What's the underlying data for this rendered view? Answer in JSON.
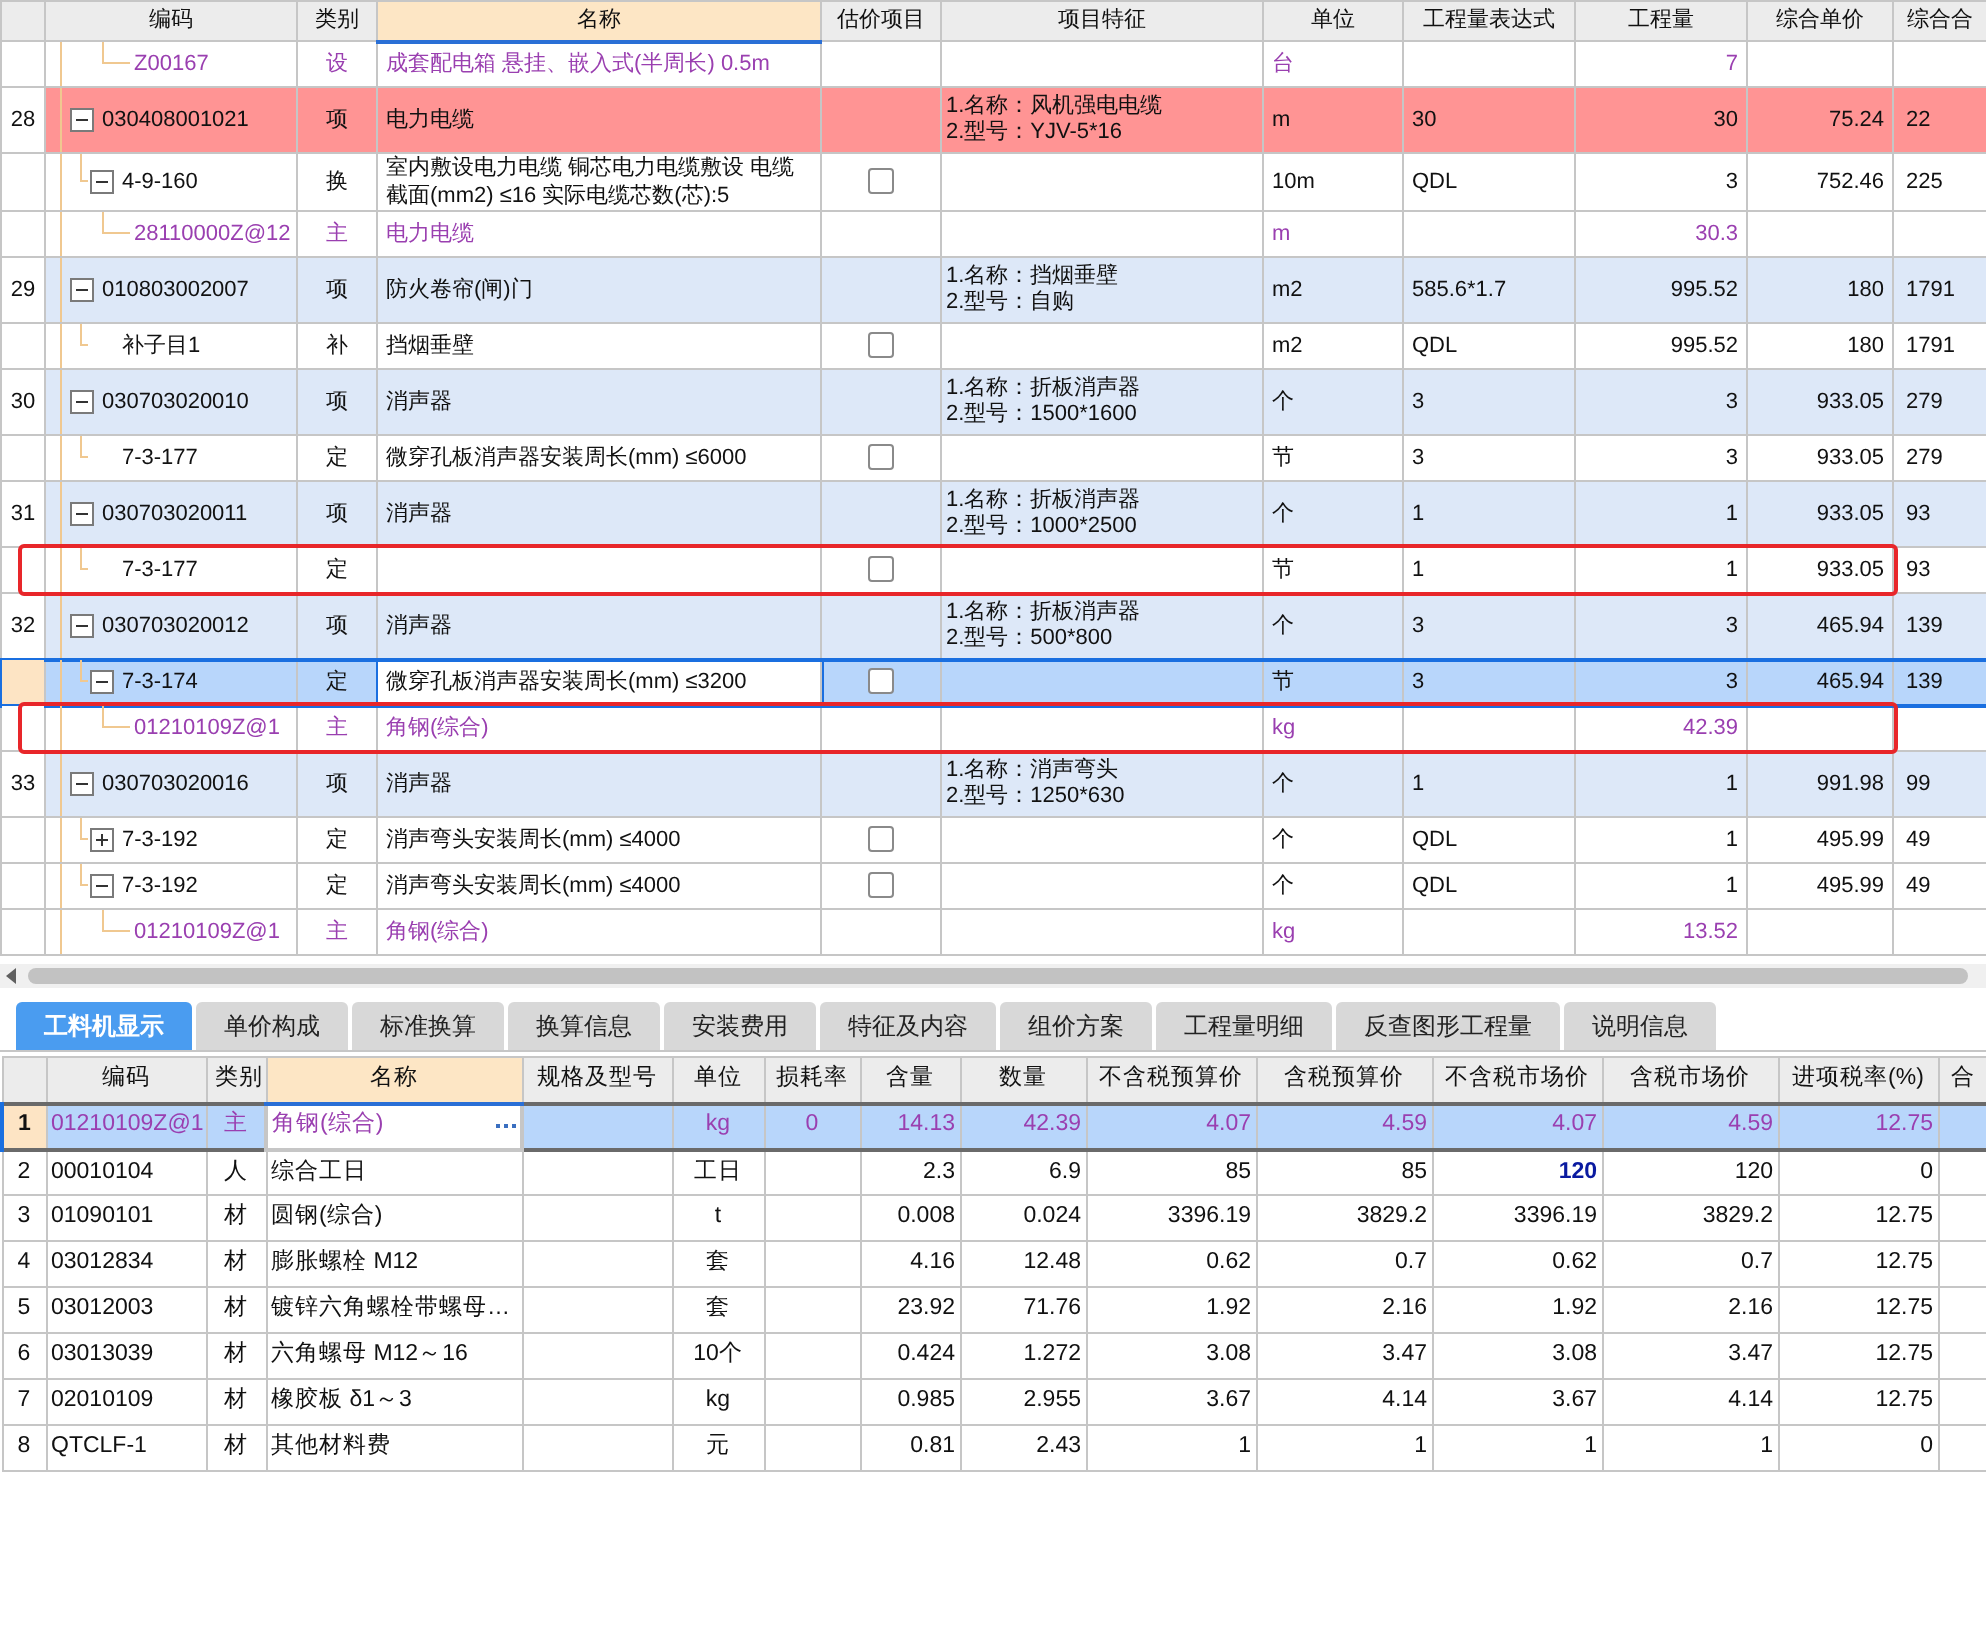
{
  "top_table": {
    "columns": [
      {
        "label": "编码",
        "selected": false
      },
      {
        "label": "类别",
        "selected": false
      },
      {
        "label": "名称",
        "selected": true
      },
      {
        "label": "估价项目",
        "selected": false
      },
      {
        "label": "项目特征",
        "selected": false
      },
      {
        "label": "单位",
        "selected": false
      },
      {
        "label": "工程量表达式",
        "selected": false
      },
      {
        "label": "工程量",
        "selected": false
      },
      {
        "label": "综合单价",
        "selected": false
      },
      {
        "label": "综合合",
        "selected": false
      }
    ],
    "rows": [
      {
        "code": "Z00167",
        "type": "设",
        "kind": "material",
        "name": "成套配电箱 悬挂、嵌入式(半周长) 0.5m",
        "unit": "台",
        "quantity": "7",
        "selected": false,
        "highlighted": false
      },
      {
        "number": "28",
        "code": "030408001021",
        "type": "项",
        "kind": "bill",
        "name": "电力电缆",
        "features": [
          "1.名称：风机强电电缆",
          "2.型号：YJV-5*16"
        ],
        "unit": "m",
        "expression": "30",
        "quantity": "30",
        "unit_price": "75.24",
        "total": "22",
        "alert": true,
        "expanded": true,
        "selected": false,
        "highlighted": false,
        "children": [
          {
            "code": "4-9-160",
            "type": "换",
            "kind": "quota",
            "name": "室内敷设电力电缆 铜芯电力电缆敷设 电缆截面(mm2) ≤16  实际电缆芯数(芯):5",
            "estimate": false,
            "unit": "10m",
            "expression": "QDL",
            "quantity": "3",
            "unit_price": "752.46",
            "total": "225",
            "expanded": true,
            "selected": false,
            "highlighted": false,
            "children": [
              {
                "code": "28110000Z@12",
                "type": "主",
                "kind": "material",
                "name": "电力电缆",
                "unit": "m",
                "quantity": "30.3",
                "selected": false,
                "highlighted": false
              }
            ]
          }
        ]
      },
      {
        "number": "29",
        "code": "010803002007",
        "type": "项",
        "kind": "bill",
        "name": "防火卷帘(闸)门",
        "features": [
          "1.名称：挡烟垂壁",
          "2.型号：自购"
        ],
        "unit": "m2",
        "expression": "585.6*1.7",
        "quantity": "995.52",
        "unit_price": "180",
        "total": "1791",
        "alert": false,
        "expanded": true,
        "selected": false,
        "highlighted": false,
        "children": [
          {
            "code": "补子目1",
            "type": "补",
            "kind": "quota",
            "name": "挡烟垂壁",
            "estimate": false,
            "unit": "m2",
            "expression": "QDL",
            "quantity": "995.52",
            "unit_price": "180",
            "total": "1791",
            "selected": false,
            "highlighted": false
          }
        ]
      },
      {
        "number": "30",
        "code": "030703020010",
        "type": "项",
        "kind": "bill",
        "name": "消声器",
        "features": [
          "1.名称：折板消声器",
          "2.型号：1500*1600"
        ],
        "unit": "个",
        "expression": "3",
        "quantity": "3",
        "unit_price": "933.05",
        "total": "279",
        "alert": false,
        "expanded": true,
        "selected": false,
        "highlighted": false,
        "children": [
          {
            "code": "7-3-177",
            "type": "定",
            "kind": "quota",
            "name": "微穿孔板消声器安装周长(mm) ≤6000",
            "estimate": false,
            "unit": "节",
            "expression": "3",
            "quantity": "3",
            "unit_price": "933.05",
            "total": "279",
            "selected": false,
            "highlighted": false
          }
        ]
      },
      {
        "number": "31",
        "code": "030703020011",
        "type": "项",
        "kind": "bill",
        "name": "消声器",
        "features": [
          "1.名称：折板消声器",
          "2.型号：1000*2500"
        ],
        "unit": "个",
        "expression": "1",
        "quantity": "1",
        "unit_price": "933.05",
        "total": "93",
        "alert": false,
        "expanded": true,
        "selected": false,
        "highlighted": false,
        "children": [
          {
            "code": "7-3-177",
            "type": "定",
            "kind": "quota",
            "estimate": false,
            "unit": "节",
            "expression": "1",
            "quantity": "1",
            "unit_price": "933.05",
            "total": "93",
            "selected": false,
            "highlighted": true
          }
        ]
      },
      {
        "number": "32",
        "code": "030703020012",
        "type": "项",
        "kind": "bill",
        "name": "消声器",
        "features": [
          "1.名称：折板消声器",
          "2.型号：500*800"
        ],
        "unit": "个",
        "expression": "3",
        "quantity": "3",
        "unit_price": "465.94",
        "total": "139",
        "alert": false,
        "expanded": true,
        "selected": false,
        "highlighted": false,
        "children": [
          {
            "code": "7-3-174",
            "type": "定",
            "kind": "quota",
            "name": "微穿孔板消声器安装周长(mm) ≤3200",
            "estimate": false,
            "unit": "节",
            "expression": "3",
            "quantity": "3",
            "unit_price": "465.94",
            "total": "139",
            "expanded": true,
            "selected": true,
            "highlighted": false,
            "children": [
              {
                "code": "01210109Z@1",
                "type": "主",
                "kind": "material",
                "name": "角钢(综合)",
                "unit": "kg",
                "quantity": "42.39",
                "selected": false,
                "highlighted": true
              }
            ]
          }
        ]
      },
      {
        "number": "33",
        "code": "030703020016",
        "type": "项",
        "kind": "bill",
        "name": "消声器",
        "features": [
          "1.名称：消声弯头",
          "2.型号：1250*630"
        ],
        "unit": "个",
        "expression": "1",
        "quantity": "1",
        "unit_price": "991.98",
        "total": "99",
        "alert": false,
        "expanded": true,
        "selected": false,
        "highlighted": false,
        "children": [
          {
            "code": "7-3-192",
            "type": "定",
            "kind": "quota",
            "name": "消声弯头安装周长(mm) ≤4000",
            "estimate": false,
            "unit": "个",
            "expression": "QDL",
            "quantity": "1",
            "unit_price": "495.99",
            "total": "49",
            "expanded": false,
            "selected": false,
            "highlighted": false
          },
          {
            "code": "7-3-192",
            "type": "定",
            "kind": "quota",
            "name": "消声弯头安装周长(mm) ≤4000",
            "estimate": false,
            "unit": "个",
            "expression": "QDL",
            "quantity": "1",
            "unit_price": "495.99",
            "total": "49",
            "expanded": true,
            "selected": false,
            "highlighted": false,
            "children": [
              {
                "code": "01210109Z@1",
                "type": "主",
                "kind": "material",
                "name": "角钢(综合)",
                "unit": "kg",
                "quantity": "13.52",
                "selected": false,
                "highlighted": false
              }
            ]
          }
        ]
      }
    ]
  },
  "tabs": [
    {
      "label": "工料机显示",
      "selected": true
    },
    {
      "label": "单价构成",
      "selected": false
    },
    {
      "label": "标准换算",
      "selected": false
    },
    {
      "label": "换算信息",
      "selected": false
    },
    {
      "label": "安装费用",
      "selected": false
    },
    {
      "label": "特征及内容",
      "selected": false
    },
    {
      "label": "组价方案",
      "selected": false
    },
    {
      "label": "工程量明细",
      "selected": false
    },
    {
      "label": "反查图形工程量",
      "selected": false
    },
    {
      "label": "说明信息",
      "selected": false
    }
  ],
  "bottom_table": {
    "columns": [
      {
        "label": "编码",
        "selected": false
      },
      {
        "label": "类别",
        "selected": false
      },
      {
        "label": "名称",
        "selected": true
      },
      {
        "label": "规格及型号",
        "selected": false
      },
      {
        "label": "单位",
        "selected": false
      },
      {
        "label": "损耗率",
        "selected": false
      },
      {
        "label": "含量",
        "selected": false
      },
      {
        "label": "数量",
        "selected": false
      },
      {
        "label": "不含税预算价",
        "selected": false
      },
      {
        "label": "含税预算价",
        "selected": false
      },
      {
        "label": "不含税市场价",
        "selected": false
      },
      {
        "label": "含税市场价",
        "selected": false
      },
      {
        "label": "进项税率(%)",
        "selected": false
      },
      {
        "label": "合",
        "selected": false
      }
    ],
    "rows": [
      {
        "number": "1",
        "code": "01210109Z@1",
        "type": "主",
        "kind": "material",
        "name": "角钢(综合)",
        "unit": "kg",
        "loss_rate": "0",
        "content": "14.13",
        "amount": "42.39",
        "budget_excl_tax": "4.07",
        "budget_incl_tax": "4.59",
        "market_excl_tax": "4.07",
        "market_incl_tax": "4.59",
        "tax_rate": "12.75",
        "selected": true,
        "market_modified": false
      },
      {
        "number": "2",
        "code": "00010104",
        "type": "人",
        "kind": "labor",
        "name": "综合工日",
        "unit": "工日",
        "content": "2.3",
        "amount": "6.9",
        "budget_excl_tax": "85",
        "budget_incl_tax": "85",
        "market_excl_tax": "120",
        "market_incl_tax": "120",
        "tax_rate": "0",
        "selected": false,
        "market_modified": true
      },
      {
        "number": "3",
        "code": "01090101",
        "type": "材",
        "kind": "material_cost",
        "name": "圆钢(综合)",
        "unit": "t",
        "content": "0.008",
        "amount": "0.024",
        "budget_excl_tax": "3396.19",
        "budget_incl_tax": "3829.2",
        "market_excl_tax": "3396.19",
        "market_incl_tax": "3829.2",
        "tax_rate": "12.75",
        "selected": false,
        "market_modified": false
      },
      {
        "number": "4",
        "code": "03012834",
        "type": "材",
        "kind": "material_cost",
        "name": "膨胀螺栓 M12",
        "unit": "套",
        "content": "4.16",
        "amount": "12.48",
        "budget_excl_tax": "0.62",
        "budget_incl_tax": "0.7",
        "market_excl_tax": "0.62",
        "market_incl_tax": "0.7",
        "tax_rate": "12.75",
        "selected": false,
        "market_modified": false
      },
      {
        "number": "5",
        "code": "03012003",
        "type": "材",
        "kind": "material_cost",
        "name": "镀锌六角螺栓带螺母…",
        "unit": "套",
        "content": "23.92",
        "amount": "71.76",
        "budget_excl_tax": "1.92",
        "budget_incl_tax": "2.16",
        "market_excl_tax": "1.92",
        "market_incl_tax": "2.16",
        "tax_rate": "12.75",
        "selected": false,
        "market_modified": false
      },
      {
        "number": "6",
        "code": "03013039",
        "type": "材",
        "kind": "material_cost",
        "name": "六角螺母 M12～16",
        "unit": "10个",
        "content": "0.424",
        "amount": "1.272",
        "budget_excl_tax": "3.08",
        "budget_incl_tax": "3.47",
        "market_excl_tax": "3.08",
        "market_incl_tax": "3.47",
        "tax_rate": "12.75",
        "selected": false,
        "market_modified": false
      },
      {
        "number": "7",
        "code": "02010109",
        "type": "材",
        "kind": "material_cost",
        "name": "橡胶板 δ1～3",
        "unit": "kg",
        "content": "0.985",
        "amount": "2.955",
        "budget_excl_tax": "3.67",
        "budget_incl_tax": "4.14",
        "market_excl_tax": "3.67",
        "market_incl_tax": "4.14",
        "tax_rate": "12.75",
        "selected": false,
        "market_modified": false
      },
      {
        "number": "8",
        "code": "QTCLF-1",
        "type": "材",
        "kind": "material_cost",
        "name": "其他材料费",
        "unit": "元",
        "content": "0.81",
        "amount": "2.43",
        "budget_excl_tax": "1",
        "budget_incl_tax": "1",
        "market_excl_tax": "1",
        "market_incl_tax": "1",
        "tax_rate": "0",
        "selected": false,
        "market_modified": false
      }
    ]
  }
}
